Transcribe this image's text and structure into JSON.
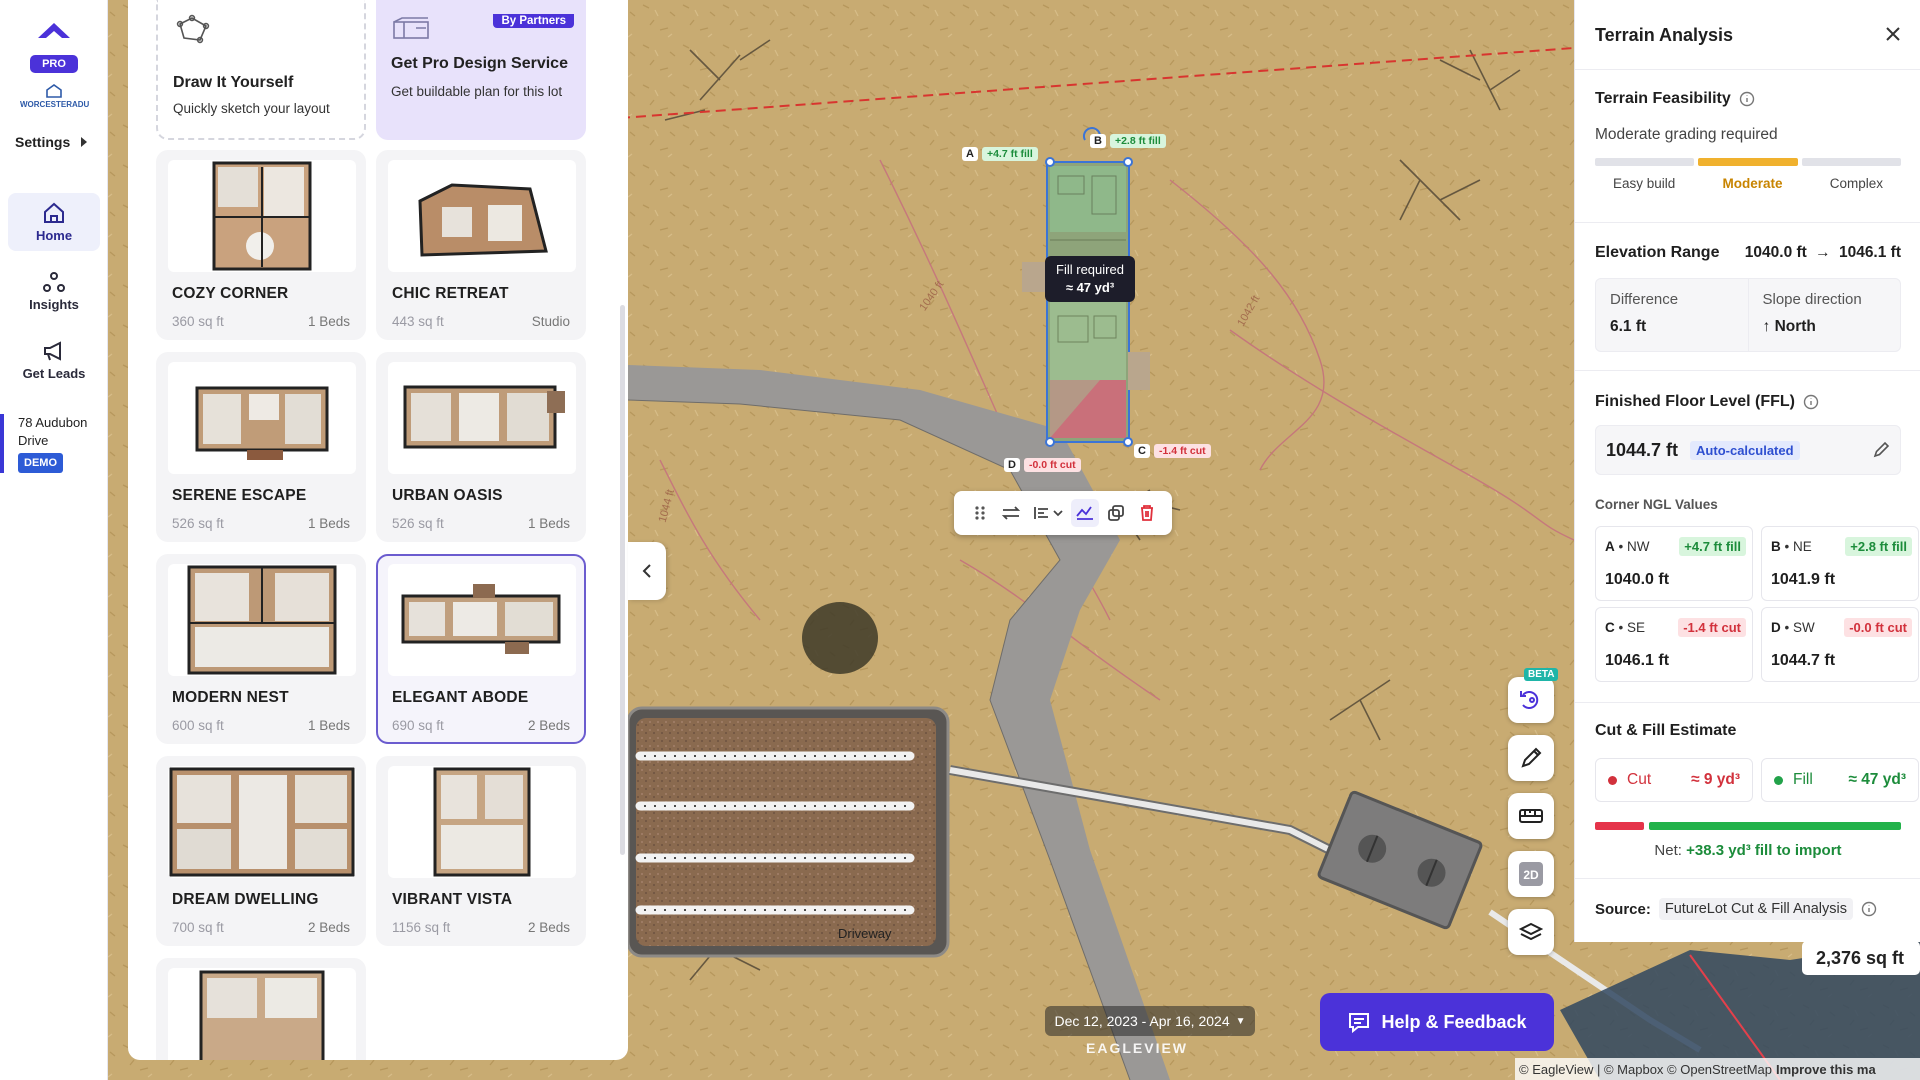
{
  "nav": {
    "pro": "PRO",
    "org": "WORCESTERADU",
    "settings": "Settings",
    "items": [
      {
        "label": "Home"
      },
      {
        "label": "Insights"
      },
      {
        "label": "Get Leads"
      }
    ],
    "address_line1": "78 Audubon",
    "address_line2": "Drive",
    "demo": "DEMO"
  },
  "designs": {
    "diy": {
      "title": "Draw It Yourself",
      "subtitle": "Quickly sketch your layout"
    },
    "pro": {
      "badge": "By Partners",
      "title": "Get Pro Design Service",
      "subtitle": "Get buildable plan for this lot"
    },
    "cards": [
      {
        "name": "COZY CORNER",
        "sqft": "360 sq ft",
        "beds": "1 Beds"
      },
      {
        "name": "CHIC RETREAT",
        "sqft": "443 sq ft",
        "beds": "Studio"
      },
      {
        "name": "SERENE ESCAPE",
        "sqft": "526 sq ft",
        "beds": "1 Beds"
      },
      {
        "name": "URBAN OASIS",
        "sqft": "526 sq ft",
        "beds": "1 Beds"
      },
      {
        "name": "MODERN NEST",
        "sqft": "600 sq ft",
        "beds": "1 Beds"
      },
      {
        "name": "ELEGANT ABODE",
        "sqft": "690 sq ft",
        "beds": "2 Beds"
      },
      {
        "name": "DREAM DWELLING",
        "sqft": "700 sq ft",
        "beds": "2 Beds"
      },
      {
        "name": "VIBRANT VISTA",
        "sqft": "1156 sq ft",
        "beds": "2 Beds"
      }
    ]
  },
  "map": {
    "corners": {
      "a": {
        "letter": "A",
        "value": "+4.7 ft fill"
      },
      "b": {
        "letter": "B",
        "value": "+2.8 ft fill"
      },
      "c": {
        "letter": "C",
        "value": "-1.4 ft cut"
      },
      "d": {
        "letter": "D",
        "value": "-0.0 ft cut"
      }
    },
    "fill_tip_line1": "Fill required",
    "fill_tip_line2": "≈ 47 yd³",
    "contours": [
      "1040 ft",
      "1042 ft",
      "1044 ft"
    ],
    "driveway": "Driveway",
    "beta": "BETA",
    "date_range": "Dec 12, 2023 - Apr 16, 2024",
    "eagleview": "EAGLEVIEW",
    "help": "Help & Feedback",
    "area": "2,376 sq ft",
    "attribution": "© EagleView | © Mapbox © OpenStreetMap",
    "improve": "Improve this ma"
  },
  "terrain": {
    "title": "Terrain Analysis",
    "feasibility": {
      "heading": "Terrain Feasibility",
      "status": "Moderate grading required",
      "levels": [
        "Easy build",
        "Moderate",
        "Complex"
      ]
    },
    "elevation": {
      "heading": "Elevation Range",
      "from": "1040.0 ft",
      "to": "1046.1 ft",
      "diff_label": "Difference",
      "diff_value": "6.1 ft",
      "slope_label": "Slope direction",
      "slope_value": "North"
    },
    "ffl": {
      "heading": "Finished Floor Level (FFL)",
      "value": "1044.7 ft",
      "badge": "Auto-calculated"
    },
    "corner_heading": "Corner NGL Values",
    "corners": [
      {
        "id": "A",
        "dir": "NW",
        "delta": "+4.7 ft fill",
        "value": "1040.0 ft",
        "kind": "fill"
      },
      {
        "id": "B",
        "dir": "NE",
        "delta": "+2.8 ft fill",
        "value": "1041.9 ft",
        "kind": "fill"
      },
      {
        "id": "C",
        "dir": "SE",
        "delta": "-1.4 ft cut",
        "value": "1046.1 ft",
        "kind": "cut"
      },
      {
        "id": "D",
        "dir": "SW",
        "delta": "-0.0 ft cut",
        "value": "1044.7 ft",
        "kind": "cut"
      }
    ],
    "cutfill": {
      "heading": "Cut & Fill Estimate",
      "cut_label": "Cut",
      "cut_value": "≈ 9 yd³",
      "fill_label": "Fill",
      "fill_value": "≈ 47 yd³",
      "cut_fraction": 0.16,
      "net_label": "Net:",
      "net_value": "+38.3 yd³ fill to import"
    },
    "source_label": "Source:",
    "source_value": "FutureLot Cut & Fill Analysis"
  },
  "colors": {
    "accent": "#4b32d9",
    "fill": "#1c8c3b",
    "cut": "#d2313c",
    "moderate": "#f0b12e"
  }
}
